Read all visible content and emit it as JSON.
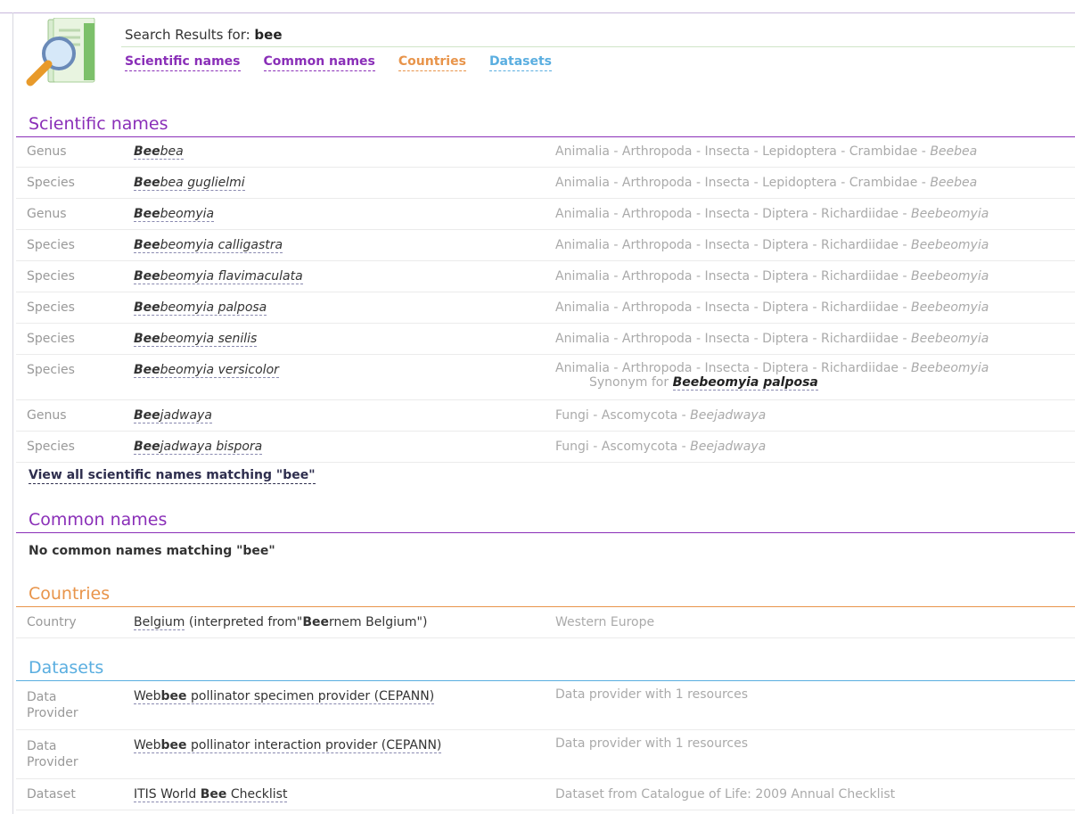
{
  "header": {
    "search_prefix": "Search Results for: ",
    "query": "bee",
    "tabs": [
      {
        "label": "Scientific names",
        "color": "#8a2fb8"
      },
      {
        "label": "Common names",
        "color": "#8a2fb8"
      },
      {
        "label": "Countries",
        "color": "#e8944a"
      },
      {
        "label": "Datasets",
        "color": "#5aaee0"
      }
    ]
  },
  "scientific": {
    "title": "Scientific names",
    "rows": [
      {
        "rank": "Genus",
        "match": "Bee",
        "rest": "bea",
        "classification": "Animalia - Arthropoda - Insecta - Lepidoptera - Crambidae - ",
        "genus": "Beebea"
      },
      {
        "rank": "Species",
        "match": "Bee",
        "rest": "bea guglielmi",
        "classification": "Animalia - Arthropoda - Insecta - Lepidoptera - Crambidae - ",
        "genus": "Beebea"
      },
      {
        "rank": "Genus",
        "match": "Bee",
        "rest": "beomyia",
        "classification": "Animalia - Arthropoda - Insecta - Diptera - Richardiidae - ",
        "genus": "Beebeomyia"
      },
      {
        "rank": "Species",
        "match": "Bee",
        "rest": "beomyia calligastra",
        "classification": "Animalia - Arthropoda - Insecta - Diptera - Richardiidae - ",
        "genus": "Beebeomyia"
      },
      {
        "rank": "Species",
        "match": "Bee",
        "rest": "beomyia flavimaculata",
        "classification": "Animalia - Arthropoda - Insecta - Diptera - Richardiidae - ",
        "genus": "Beebeomyia"
      },
      {
        "rank": "Species",
        "match": "Bee",
        "rest": "beomyia palposa",
        "classification": "Animalia - Arthropoda - Insecta - Diptera - Richardiidae - ",
        "genus": "Beebeomyia"
      },
      {
        "rank": "Species",
        "match": "Bee",
        "rest": "beomyia senilis",
        "classification": "Animalia - Arthropoda - Insecta - Diptera - Richardiidae - ",
        "genus": "Beebeomyia"
      },
      {
        "rank": "Species",
        "match": "Bee",
        "rest": "beomyia versicolor",
        "classification": "Animalia - Arthropoda - Insecta - Diptera - Richardiidae - ",
        "genus": "Beebeomyia",
        "synonym_prefix": "Synonym for ",
        "synonym_name": "Beebeomyia palposa"
      },
      {
        "rank": "Genus",
        "match": "Bee",
        "rest": "jadwaya",
        "classification": "Fungi - Ascomycota - ",
        "genus": "Beejadwaya"
      },
      {
        "rank": "Species",
        "match": "Bee",
        "rest": "jadwaya bispora",
        "classification": "Fungi - Ascomycota - ",
        "genus": "Beejadwaya"
      }
    ],
    "view_all": "View all scientific names matching \"bee\""
  },
  "common": {
    "title": "Common names",
    "empty": "No common names matching \"bee\""
  },
  "countries": {
    "title": "Countries",
    "rows": [
      {
        "type": "Country",
        "name": "Belgium",
        "note_prefix": " (interpreted from\"",
        "match": "Bee",
        "note_rest": "rnem Belgium\")",
        "region": "Western Europe"
      }
    ]
  },
  "datasets": {
    "title": "Datasets",
    "rows": [
      {
        "type_l1": "Data",
        "type_l2": "Provider",
        "pre": "Web",
        "match": "bee",
        "post": " pollinator specimen provider (CEPANN)",
        "desc": "Data provider with 1 resources"
      },
      {
        "type_l1": "Data",
        "type_l2": "Provider",
        "pre": "Web",
        "match": "bee",
        "post": " pollinator interaction provider (CEPANN)",
        "desc": "Data provider with 1 resources"
      },
      {
        "type_l1": "Dataset",
        "type_l2": "",
        "pre": "ITIS World ",
        "match": "Bee",
        "post": " Checklist",
        "desc": "Dataset from Catalogue of Life: 2009 Annual Checklist"
      }
    ]
  }
}
